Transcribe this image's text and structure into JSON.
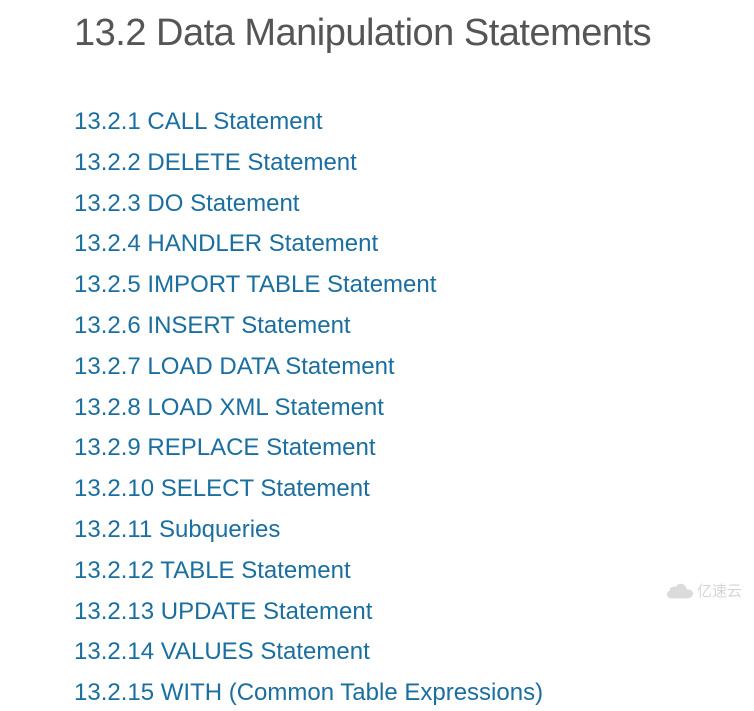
{
  "title": "13.2 Data Manipulation Statements",
  "toc": [
    {
      "label": "13.2.1 CALL Statement"
    },
    {
      "label": "13.2.2 DELETE Statement"
    },
    {
      "label": "13.2.3 DO Statement"
    },
    {
      "label": "13.2.4 HANDLER Statement"
    },
    {
      "label": "13.2.5 IMPORT TABLE Statement"
    },
    {
      "label": "13.2.6 INSERT Statement"
    },
    {
      "label": "13.2.7 LOAD DATA Statement"
    },
    {
      "label": "13.2.8 LOAD XML Statement"
    },
    {
      "label": "13.2.9 REPLACE Statement"
    },
    {
      "label": "13.2.10 SELECT Statement"
    },
    {
      "label": "13.2.11 Subqueries"
    },
    {
      "label": "13.2.12 TABLE Statement"
    },
    {
      "label": "13.2.13 UPDATE Statement"
    },
    {
      "label": "13.2.14 VALUES Statement"
    },
    {
      "label": "13.2.15 WITH (Common Table Expressions)"
    }
  ],
  "watermark": "亿速云"
}
